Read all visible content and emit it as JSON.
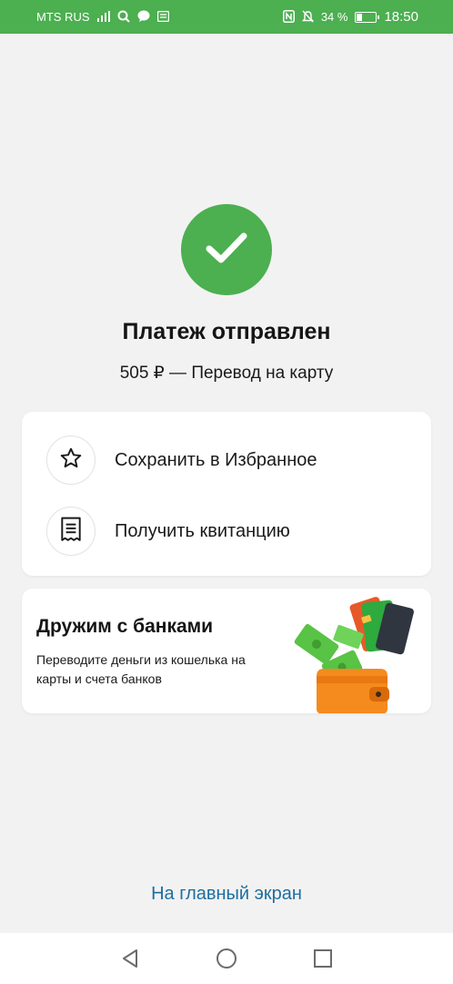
{
  "status_bar": {
    "carrier": "MTS RUS",
    "battery_percent": "34 %",
    "battery_level": 0.34,
    "time": "18:50",
    "icons": [
      "signal-icon",
      "search-icon",
      "chat-icon",
      "notification-icon",
      "nfc-icon",
      "mute-icon",
      "battery-icon"
    ]
  },
  "result": {
    "icon": "check-icon",
    "title": "Платеж отправлен",
    "subtitle": "505 ₽ — Перевод на карту"
  },
  "actions": [
    {
      "icon": "star-icon",
      "label": "Сохранить в Избранное"
    },
    {
      "icon": "receipt-icon",
      "label": "Получить квитанцию"
    }
  ],
  "promo": {
    "title": "Дружим с банками",
    "text": "Переводите деньги из кошелька на карты и счета банков"
  },
  "footer": {
    "home_link": "На главный экран"
  },
  "colors": {
    "accent_green": "#4caf50",
    "link_blue": "#1e6ea0",
    "background": "#f2f2f2"
  }
}
